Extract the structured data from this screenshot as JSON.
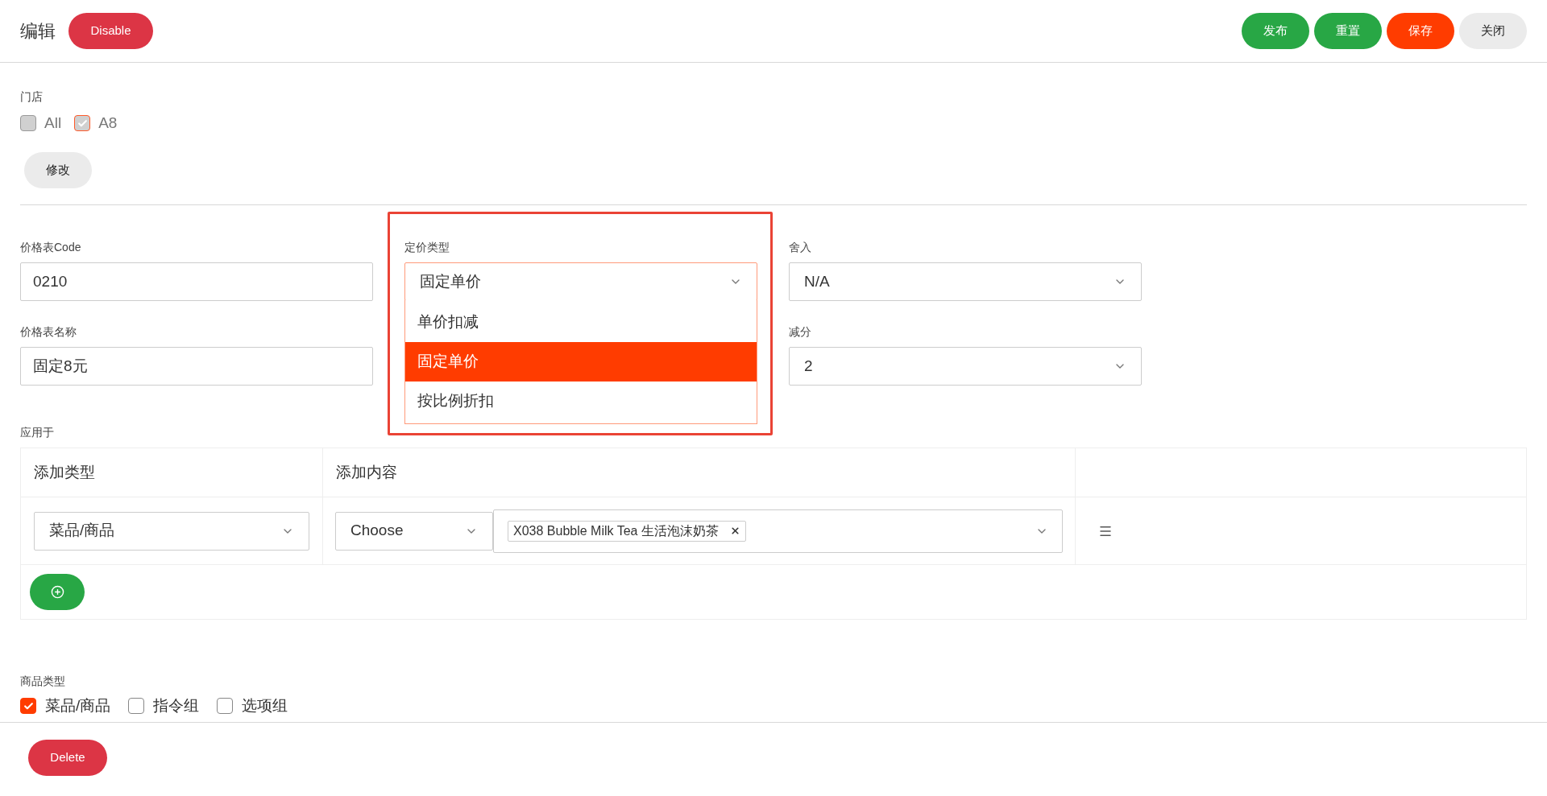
{
  "header": {
    "title": "编辑",
    "status_button": {
      "label": "Disable",
      "kind": "danger"
    },
    "actions": [
      {
        "label": "发布",
        "kind": "success"
      },
      {
        "label": "重置",
        "kind": "success"
      },
      {
        "label": "保存",
        "kind": "primary"
      },
      {
        "label": "关闭",
        "kind": "default"
      }
    ]
  },
  "stores": {
    "label": "门店",
    "options": [
      {
        "label": "All",
        "checked": false,
        "disabled": true
      },
      {
        "label": "A8",
        "checked": true,
        "disabled": true
      }
    ],
    "edit_button": "修改"
  },
  "price_code": {
    "label": "价格表Code",
    "value": "0210"
  },
  "price_name": {
    "label": "价格表名称",
    "value": "固定8元"
  },
  "pricing_type": {
    "label": "定价类型",
    "value": "固定单价",
    "expanded": true,
    "options": [
      {
        "label": "单价扣减",
        "selected": false
      },
      {
        "label": "固定单价",
        "selected": true
      },
      {
        "label": "按比例折扣",
        "selected": false
      }
    ]
  },
  "rounding": {
    "label": "舍入",
    "value": "N/A"
  },
  "deduction": {
    "label": "减分",
    "value": "2"
  },
  "applies_to": {
    "label": "应用于",
    "columns": [
      "添加类型",
      "添加内容"
    ],
    "rows": [
      {
        "type": "菜品/商品",
        "mode": "Choose",
        "tags": [
          {
            "label": "X038 Bubble Milk Tea 生活泡沫奶茶"
          }
        ]
      }
    ]
  },
  "product_types": {
    "label": "商品类型",
    "options": [
      {
        "label": "菜品/商品",
        "checked": true
      },
      {
        "label": "指令组",
        "checked": false
      },
      {
        "label": "选项组",
        "checked": false
      }
    ]
  },
  "delete_button": {
    "label": "Delete",
    "kind": "danger"
  }
}
